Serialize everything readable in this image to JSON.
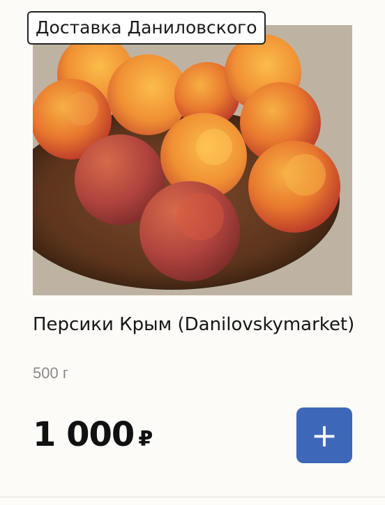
{
  "store_badge": {
    "label": "Доставка Даниловского"
  },
  "product": {
    "image_alt": "peaches",
    "title": "Персики Крым (Danilovskymarket)",
    "weight": "500 г",
    "price": "1 000",
    "currency": "₽"
  },
  "actions": {
    "add_label": "+"
  },
  "colors": {
    "accent": "#3d67b8",
    "background": "#fcfbf8"
  }
}
